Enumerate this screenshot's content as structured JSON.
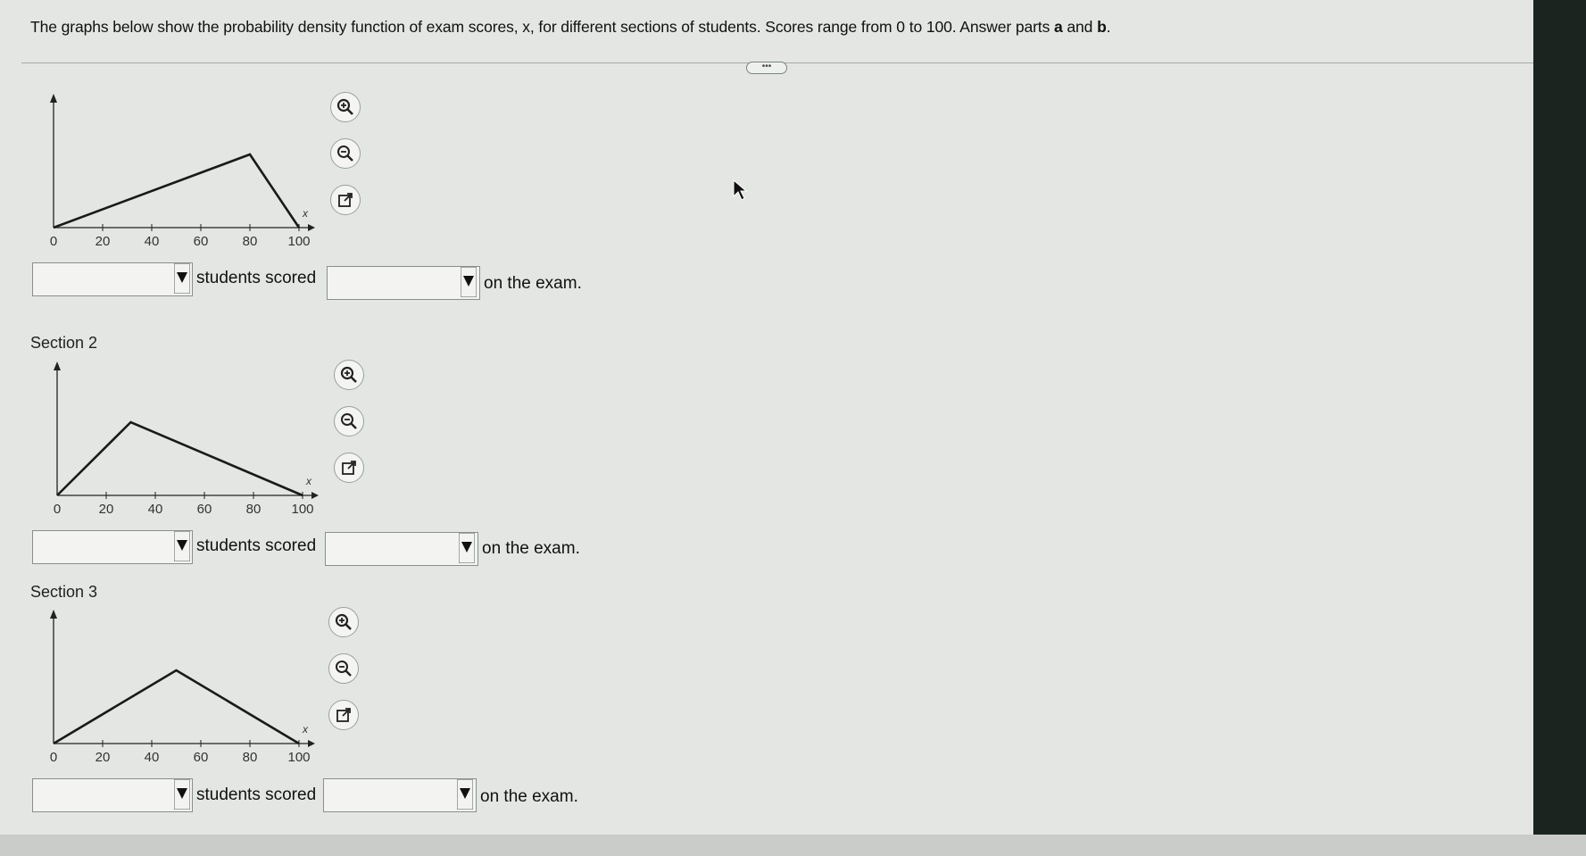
{
  "instructions": {
    "text_before": "The graphs below show the probability density function of exam scores, x, for different sections of students. Scores range from 0 to 100. Answer parts ",
    "part_a": "a",
    "and": " and ",
    "part_b": "b",
    "period": "."
  },
  "more_button_label": "•••",
  "axis": {
    "ticks": [
      "0",
      "20",
      "40",
      "60",
      "80",
      "100"
    ],
    "x_label": "x"
  },
  "sections": [
    {
      "label": "",
      "density_shape": [
        [
          0,
          0
        ],
        [
          80,
          1
        ],
        [
          100,
          0
        ]
      ],
      "answer": {
        "left_value": "",
        "middle_text": "students scored",
        "right_value": "",
        "end_text": "on the exam."
      }
    },
    {
      "label": "Section 2",
      "density_shape": [
        [
          0,
          0
        ],
        [
          30,
          1
        ],
        [
          100,
          0
        ]
      ],
      "answer": {
        "left_value": "",
        "middle_text": "students scored",
        "right_value": "",
        "end_text": "on the exam."
      }
    },
    {
      "label": "Section 3",
      "density_shape": [
        [
          0,
          0
        ],
        [
          50,
          1
        ],
        [
          100,
          0
        ]
      ],
      "answer": {
        "left_value": "",
        "middle_text": "students scored",
        "right_value": "",
        "end_text": "on the exam."
      }
    }
  ],
  "tools": [
    "zoom-in-icon",
    "zoom-out-icon",
    "open-external-icon"
  ],
  "colors": {
    "screen": "#e3e6e2",
    "line": "#1a1a1a"
  }
}
